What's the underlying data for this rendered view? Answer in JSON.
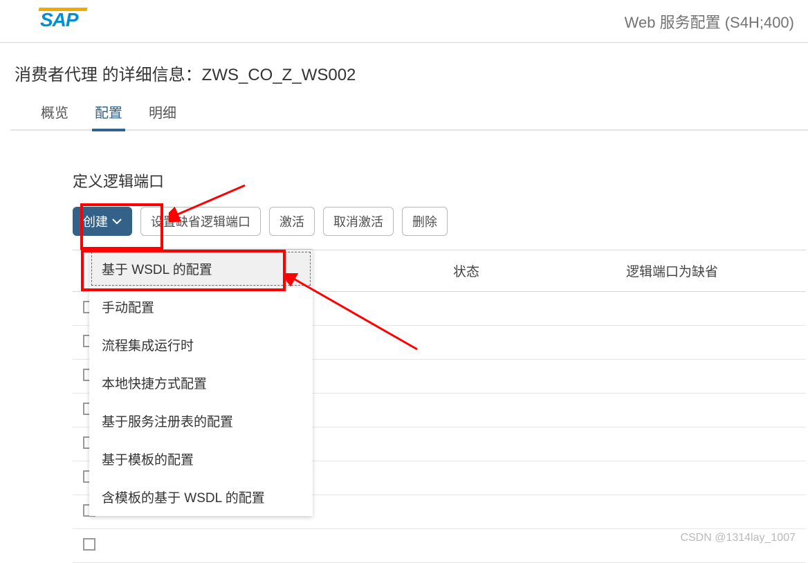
{
  "header": {
    "logo_text": "SAP",
    "app_title": "Web 服务配置 (S4H;400)"
  },
  "page_title": "消费者代理 的详细信息：ZWS_CO_Z_WS002",
  "tabs": {
    "t1": "概览",
    "t2": "配置",
    "t3": "明细",
    "active": "t2"
  },
  "section": {
    "title": "定义逻辑端口"
  },
  "toolbar": {
    "create_label": "创建",
    "set_default_label": "设置缺省逻辑端口",
    "activate_label": "激活",
    "deactivate_label": "取消激活",
    "delete_label": "删除"
  },
  "create_menu": {
    "items": [
      "基于 WSDL 的配置",
      "手动配置",
      "流程集成运行时",
      "本地快捷方式配置",
      "基于服务注册表的配置",
      "基于模板的配置",
      "含模板的基于 WSDL 的配置"
    ],
    "highlighted_index": 0
  },
  "table": {
    "columns": {
      "c1": "",
      "c2": "状态",
      "c3": "逻辑端口为缺省"
    },
    "rows_count": 8
  },
  "watermark": "CSDN @1314lay_1007"
}
